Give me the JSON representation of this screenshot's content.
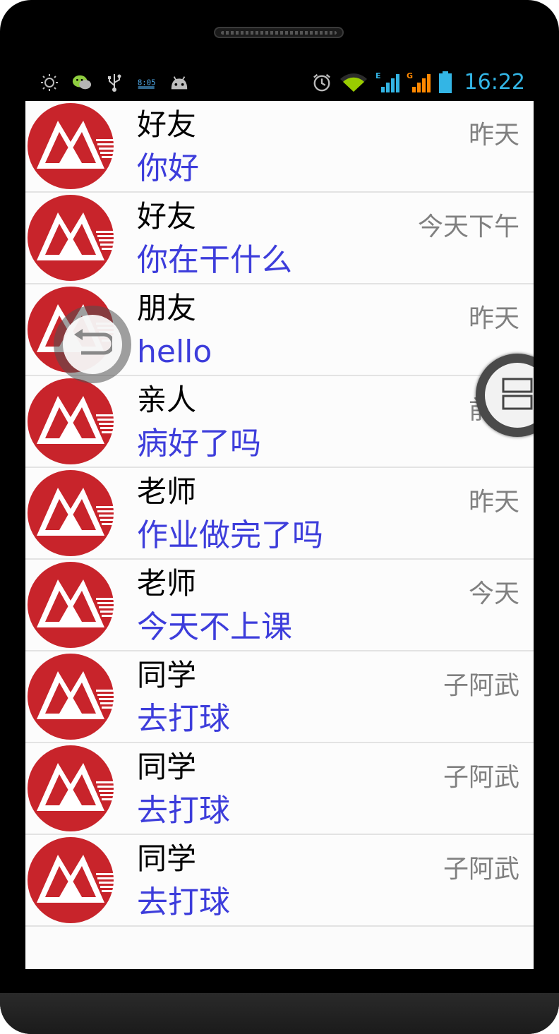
{
  "status_bar": {
    "time": "16:22",
    "left_icons": [
      "brightness-icon",
      "wechat-icon",
      "usb-icon",
      "clock-widget-icon",
      "android-icon"
    ],
    "right_icons": [
      "alarm-icon",
      "wifi-icon",
      "signal-e-icon",
      "signal-g-icon",
      "battery-icon"
    ],
    "network_e": "E",
    "network_g": "G",
    "widget_text": "8:05"
  },
  "conversations": [
    {
      "name": "好友",
      "message": "你好",
      "time": "昨天"
    },
    {
      "name": "好友",
      "message": "你在干什么",
      "time": "今天下午"
    },
    {
      "name": "朋友",
      "message": "hello",
      "time": "昨天"
    },
    {
      "name": "亲人",
      "message": "病好了吗",
      "time": "前天"
    },
    {
      "name": "老师",
      "message": "作业做完了吗",
      "time": "昨天"
    },
    {
      "name": "老师",
      "message": "今天不上课",
      "time": "今天"
    },
    {
      "name": "同学",
      "message": "去打球",
      "time": "子阿武"
    },
    {
      "name": "同学",
      "message": "去打球",
      "time": "子阿武"
    },
    {
      "name": "同学",
      "message": "去打球",
      "time": "子阿武"
    }
  ],
  "colors": {
    "accent": "#33b5e5",
    "message_text": "#3d3ddb",
    "avatar_red": "#c8242b",
    "time_text": "#808080"
  },
  "floating_buttons": [
    "back-icon",
    "recent-apps-icon"
  ]
}
